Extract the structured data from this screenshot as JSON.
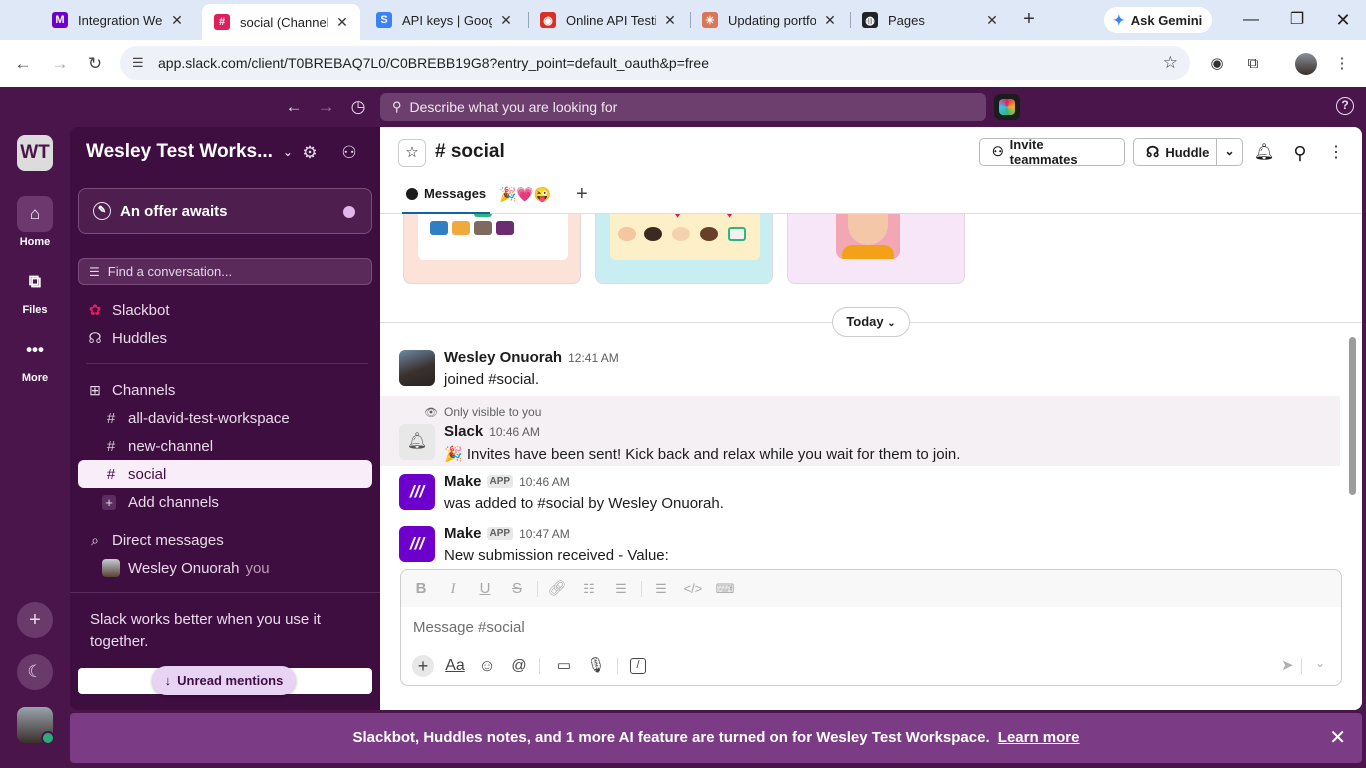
{
  "browser": {
    "tabs": [
      {
        "title": "Integration Webh",
        "favicon_color": "#6d00cc",
        "favicon_glyph": "M"
      },
      {
        "title": "social (Channel) -",
        "favicon_color": "#e01e5a",
        "favicon_glyph": "#",
        "active": true
      },
      {
        "title": "API keys | Google",
        "favicon_color": "#3b82f6",
        "favicon_glyph": "S"
      },
      {
        "title": "Online API Testin",
        "favicon_color": "#d93025",
        "favicon_glyph": "◉"
      },
      {
        "title": "Updating portfoli",
        "favicon_color": "#d97757",
        "favicon_glyph": "✳"
      },
      {
        "title": "Pages",
        "favicon_color": "#1f2328",
        "favicon_glyph": "◍"
      }
    ],
    "new_tab": "+",
    "gemini_label": "Ask Gemini",
    "url": "app.slack.com/client/T0BREBAQ7L0/C0BREBB19G8?entry_point=default_oauth&p=free"
  },
  "slack_top": {
    "search_placeholder": "Describe what you are looking for",
    "help": "?"
  },
  "rail": {
    "workspace_initials": "WT",
    "home_label": "Home",
    "files_label": "Files",
    "more_label": "More"
  },
  "sidebar": {
    "workspace_name": "Wesley Test Works...",
    "offer_label": "An offer awaits",
    "find_placeholder": "Find a conversation...",
    "items": {
      "slackbot": "Slackbot",
      "huddles": "Huddles"
    },
    "channels_header": "Channels",
    "channels": [
      {
        "name": "all-david-test-workspace"
      },
      {
        "name": "new-channel"
      },
      {
        "name": "social",
        "active": true
      }
    ],
    "add_channels": "Add channels",
    "dm_header": "Direct messages",
    "dm_user": "Wesley Onuorah",
    "dm_you": "you",
    "promo_text": "Slack works better when you use it together.",
    "unread_mentions": "Unread mentions"
  },
  "channel": {
    "name": "social",
    "invite_label": "Invite teammates",
    "huddle_label": "Huddle",
    "tabs": {
      "messages": "Messages",
      "emoji_tab": "🎉💗😜"
    },
    "date_divider": "Today"
  },
  "messages": [
    {
      "author": "Wesley Onuorah",
      "time": "12:41 AM",
      "text": "joined #social."
    },
    {
      "visibility_note": "Only visible to you",
      "author": "Slack",
      "time": "10:46 AM",
      "text": "🎉 Invites have been sent! Kick back and relax while you wait for them to join."
    },
    {
      "author": "Make",
      "tag": "APP",
      "time": "10:46 AM",
      "text": "was added to #social by Wesley Onuorah."
    },
    {
      "author": "Make",
      "tag": "APP",
      "time": "10:47 AM",
      "text": "New submission received - Value:"
    }
  ],
  "composer": {
    "placeholder": "Message #social"
  },
  "banner": {
    "text": "Slackbot, Huddles notes, and 1 more AI feature are turned on for Wesley Test Workspace.",
    "link": "Learn more"
  }
}
